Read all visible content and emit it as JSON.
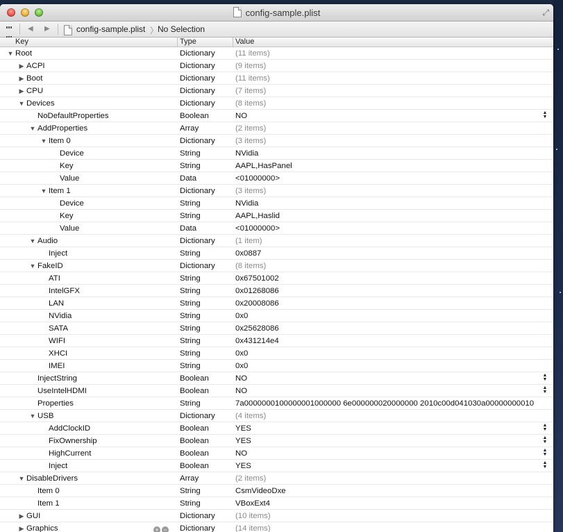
{
  "window": {
    "title": "config-sample.plist",
    "fullscreen_icon": "fullscreen-arrows-icon"
  },
  "jumpbar": {
    "file": "config-sample.plist",
    "separator": "〉",
    "selection": "No Selection"
  },
  "columns": {
    "key": "Key",
    "type": "Type",
    "value": "Value"
  },
  "rows": [
    {
      "level": 0,
      "key": "Root",
      "type": "Dictionary",
      "value": "(11 items)",
      "disclosure": "expanded",
      "count": true
    },
    {
      "level": 1,
      "key": "ACPI",
      "type": "Dictionary",
      "value": "(9 items)",
      "disclosure": "collapsed",
      "count": true
    },
    {
      "level": 1,
      "key": "Boot",
      "type": "Dictionary",
      "value": "(11 items)",
      "disclosure": "collapsed",
      "count": true
    },
    {
      "level": 1,
      "key": "CPU",
      "type": "Dictionary",
      "value": "(7 items)",
      "disclosure": "collapsed",
      "count": true
    },
    {
      "level": 1,
      "key": "Devices",
      "type": "Dictionary",
      "value": "(8 items)",
      "disclosure": "expanded",
      "count": true
    },
    {
      "level": 2,
      "key": "NoDefaultProperties",
      "type": "Boolean",
      "value": "NO",
      "disclosure": "none",
      "stepper": true
    },
    {
      "level": 2,
      "key": "AddProperties",
      "type": "Array",
      "value": "(2 items)",
      "disclosure": "expanded",
      "count": true
    },
    {
      "level": 3,
      "key": "Item 0",
      "type": "Dictionary",
      "value": "(3 items)",
      "disclosure": "expanded",
      "count": true
    },
    {
      "level": 4,
      "key": "Device",
      "type": "String",
      "value": "NVidia",
      "disclosure": "none"
    },
    {
      "level": 4,
      "key": "Key",
      "type": "String",
      "value": "AAPL,HasPanel",
      "disclosure": "none"
    },
    {
      "level": 4,
      "key": "Value",
      "type": "Data",
      "value": "<01000000>",
      "disclosure": "none"
    },
    {
      "level": 3,
      "key": "Item 1",
      "type": "Dictionary",
      "value": "(3 items)",
      "disclosure": "expanded",
      "count": true
    },
    {
      "level": 4,
      "key": "Device",
      "type": "String",
      "value": "NVidia",
      "disclosure": "none"
    },
    {
      "level": 4,
      "key": "Key",
      "type": "String",
      "value": "AAPL,Haslid",
      "disclosure": "none"
    },
    {
      "level": 4,
      "key": "Value",
      "type": "Data",
      "value": "<01000000>",
      "disclosure": "none"
    },
    {
      "level": 2,
      "key": "Audio",
      "type": "Dictionary",
      "value": "(1 item)",
      "disclosure": "expanded",
      "count": true
    },
    {
      "level": 3,
      "key": "Inject",
      "type": "String",
      "value": "0x0887",
      "disclosure": "none"
    },
    {
      "level": 2,
      "key": "FakeID",
      "type": "Dictionary",
      "value": "(8 items)",
      "disclosure": "expanded",
      "count": true
    },
    {
      "level": 3,
      "key": "ATI",
      "type": "String",
      "value": "0x67501002",
      "disclosure": "none"
    },
    {
      "level": 3,
      "key": "IntelGFX",
      "type": "String",
      "value": "0x01268086",
      "disclosure": "none"
    },
    {
      "level": 3,
      "key": "LAN",
      "type": "String",
      "value": "0x20008086",
      "disclosure": "none"
    },
    {
      "level": 3,
      "key": "NVidia",
      "type": "String",
      "value": "0x0",
      "disclosure": "none"
    },
    {
      "level": 3,
      "key": "SATA",
      "type": "String",
      "value": "0x25628086",
      "disclosure": "none"
    },
    {
      "level": 3,
      "key": "WIFI",
      "type": "String",
      "value": "0x431214e4",
      "disclosure": "none"
    },
    {
      "level": 3,
      "key": "XHCI",
      "type": "String",
      "value": "0x0",
      "disclosure": "none"
    },
    {
      "level": 3,
      "key": "IMEI",
      "type": "String",
      "value": "0x0",
      "disclosure": "none"
    },
    {
      "level": 2,
      "key": "InjectString",
      "type": "Boolean",
      "value": "NO",
      "disclosure": "none",
      "stepper": true
    },
    {
      "level": 2,
      "key": "UseIntelHDMI",
      "type": "Boolean",
      "value": "NO",
      "disclosure": "none",
      "stepper": true
    },
    {
      "level": 2,
      "key": "Properties",
      "type": "String",
      "value": "7a0000000100000001000000 6e000000020000000 2010c00d041030a00000000010",
      "disclosure": "none"
    },
    {
      "level": 2,
      "key": "USB",
      "type": "Dictionary",
      "value": "(4 items)",
      "disclosure": "expanded",
      "count": true
    },
    {
      "level": 3,
      "key": "AddClockID",
      "type": "Boolean",
      "value": "YES",
      "disclosure": "none",
      "stepper": true
    },
    {
      "level": 3,
      "key": "FixOwnership",
      "type": "Boolean",
      "value": "YES",
      "disclosure": "none",
      "stepper": true
    },
    {
      "level": 3,
      "key": "HighCurrent",
      "type": "Boolean",
      "value": "NO",
      "disclosure": "none",
      "stepper": true
    },
    {
      "level": 3,
      "key": "Inject",
      "type": "Boolean",
      "value": "YES",
      "disclosure": "none",
      "stepper": true
    },
    {
      "level": 1,
      "key": "DisableDrivers",
      "type": "Array",
      "value": "(2 items)",
      "disclosure": "expanded",
      "count": true
    },
    {
      "level": 2,
      "key": "Item 0",
      "type": "String",
      "value": "CsmVideoDxe",
      "disclosure": "none"
    },
    {
      "level": 2,
      "key": "Item 1",
      "type": "String",
      "value": "VBoxExt4",
      "disclosure": "none"
    },
    {
      "level": 1,
      "key": "GUI",
      "type": "Dictionary",
      "value": "(10 items)",
      "disclosure": "collapsed",
      "count": true
    },
    {
      "level": 1,
      "key": "Graphics",
      "type": "Dictionary",
      "value": "(14 items)",
      "disclosure": "collapsed",
      "count": true,
      "addremove": true
    }
  ]
}
